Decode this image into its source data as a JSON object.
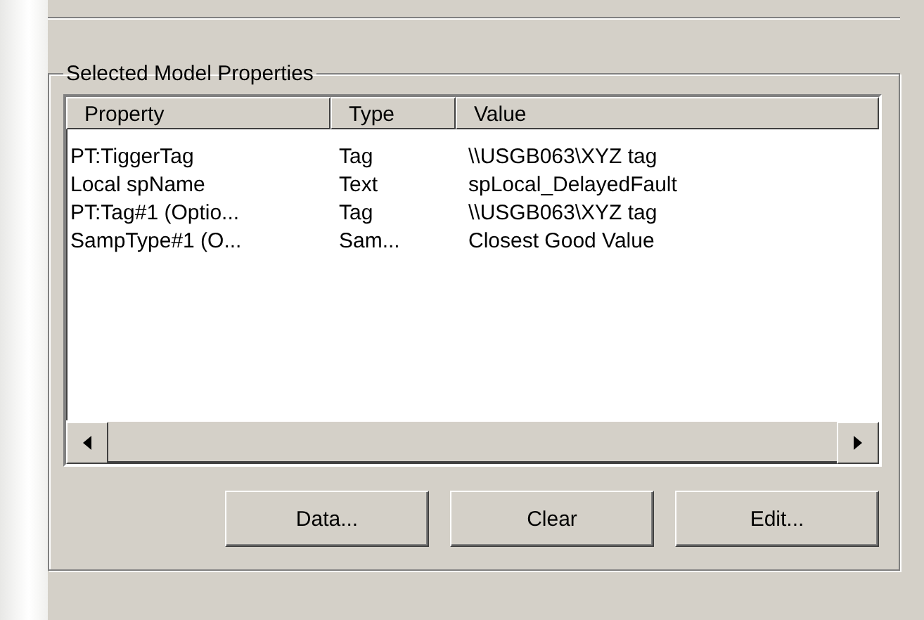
{
  "group": {
    "title": "Selected Model Properties"
  },
  "table": {
    "columns": [
      "Property",
      "Type",
      "Value"
    ],
    "rows": [
      [
        "PT:TiggerTag",
        "Tag",
        "\\\\USGB063\\XYZ tag"
      ],
      [
        "Local spName",
        "Text",
        "spLocal_DelayedFault"
      ],
      [
        "PT:Tag#1 (Optio...",
        "Tag",
        "\\\\USGB063\\XYZ tag"
      ],
      [
        "SampType#1 (O...",
        "Sam...",
        "Closest Good Value"
      ]
    ]
  },
  "buttons": [
    "Data...",
    "Clear",
    "Edit..."
  ]
}
